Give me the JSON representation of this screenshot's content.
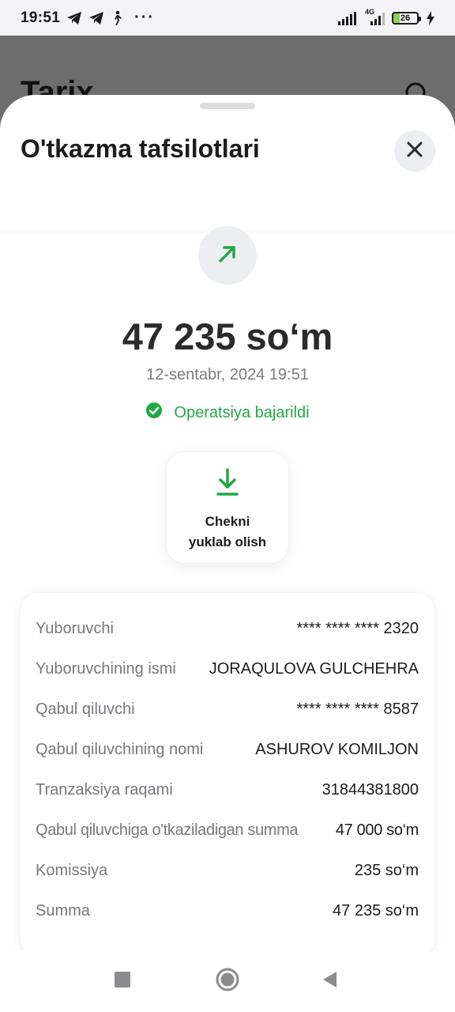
{
  "status_bar": {
    "time": "19:51",
    "network": "4G",
    "battery": "26",
    "more": "···",
    "icons": [
      "telegram-icon",
      "telegram-icon",
      "walking-icon",
      "signal-icon",
      "signal-4g-icon",
      "battery-icon",
      "charging-icon"
    ]
  },
  "background_screen": {
    "title": "Tarix",
    "icons": [
      "search-icon"
    ]
  },
  "sheet": {
    "title": "O'tkazma tafsilotlari",
    "close_icon": "close-icon",
    "direction_icon": "arrow-up-right-icon",
    "amount": "47 235 so‘m",
    "datetime": "12-sentabr, 2024 19:51",
    "status_text": "Operatsiya bajarildi",
    "status_icon": "check-circle-icon",
    "receipt_button": {
      "line1": "Chekni",
      "line2": "yuklab olish",
      "icon": "download-icon"
    },
    "details": [
      {
        "label": "Yuboruvchi",
        "value": "**** **** **** 2320"
      },
      {
        "label": "Yuboruvchining ismi",
        "value": "JORAQULOVA GULCHEHRA"
      },
      {
        "label": "Qabul qiluvchi",
        "value": "**** **** **** 8587"
      },
      {
        "label": "Qabul qiluvchining nomi",
        "value": "ASHUROV KOMILJON"
      },
      {
        "label": "Tranzaksiya raqami",
        "value": "31844381800"
      },
      {
        "label": "Qabul qiluvchiga o'tkaziladigan summa",
        "value": "47 000 so‘m"
      },
      {
        "label": "Komissiya",
        "value": "235 so‘m"
      },
      {
        "label": "Summa",
        "value": "47 235 so‘m"
      }
    ]
  },
  "nav_bar": {
    "icons": [
      "recents-square-icon",
      "home-circle-icon",
      "back-triangle-icon"
    ]
  },
  "colors": {
    "accent_green": "#22a745",
    "scrim": "#6d6d6d",
    "text_primary": "#1c1c1e",
    "text_secondary": "#77777d"
  }
}
